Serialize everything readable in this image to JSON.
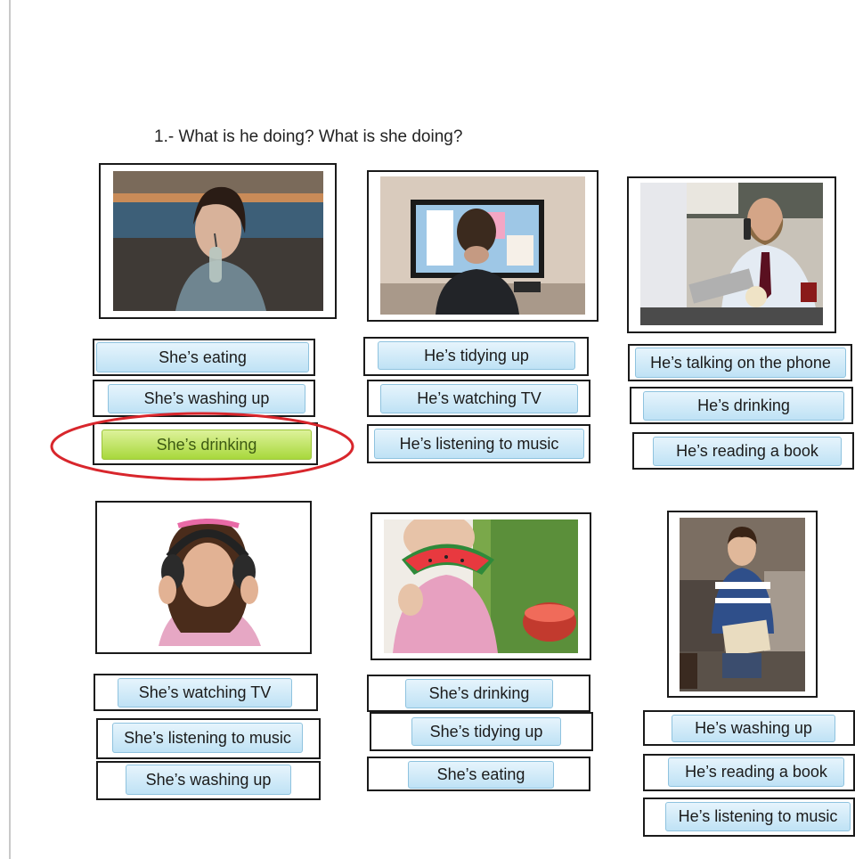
{
  "worksheet": {
    "title": "1.- What is he doing? What is she doing?",
    "accent_selected": "#a8d83c",
    "circle_color": "#d8262c"
  },
  "exercises": [
    {
      "image": "girl-drinking-photo",
      "options": [
        "She’s eating",
        "She’s washing up",
        "She’s drinking"
      ],
      "selected_index": 2
    },
    {
      "image": "boy-watching-tv-photo",
      "options": [
        "He’s tidying up",
        "He’s watching TV",
        "He’s listening to music"
      ]
    },
    {
      "image": "man-on-phone-photo",
      "options": [
        "He’s talking on the phone",
        "He’s drinking",
        "He’s reading a book"
      ]
    },
    {
      "image": "girl-headphones-photo",
      "options": [
        "She’s watching TV",
        "She’s listening to music",
        "She’s washing up"
      ]
    },
    {
      "image": "girl-eating-watermelon-photo",
      "options": [
        "She’s drinking",
        "She’s tidying up",
        "She’s eating"
      ]
    },
    {
      "image": "boy-reading-photo",
      "options": [
        "He’s washing up",
        "He’s reading a book",
        "He’s listening to music"
      ]
    }
  ]
}
